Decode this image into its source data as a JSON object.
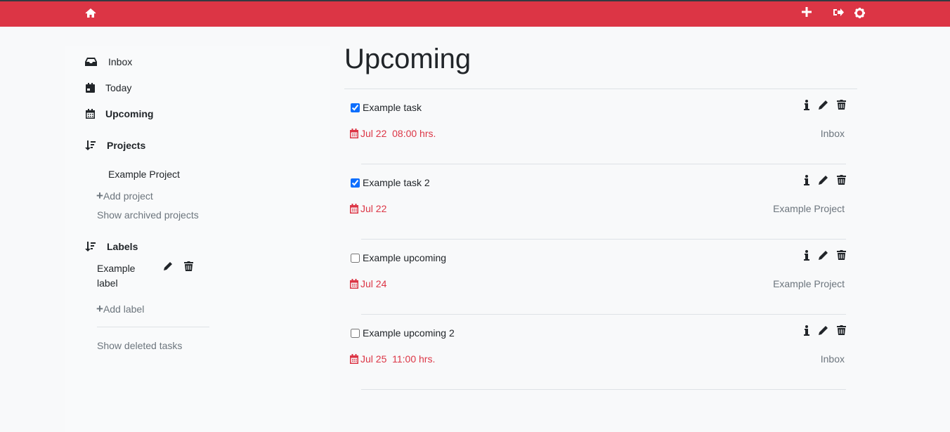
{
  "navbar": {
    "home_icon": "home-icon",
    "add_icon": "plus-icon",
    "logout_icon": "sign-out-icon",
    "settings_icon": "gear-icon",
    "brand_color": "#dc3545"
  },
  "sidebar": {
    "inbox": "Inbox",
    "today": "Today",
    "upcoming": "Upcoming",
    "projects_heading": "Projects",
    "projects": [
      "Example Project"
    ],
    "add_project": "Add project",
    "show_archived": "Show archived projects",
    "labels_heading": "Labels",
    "labels": [
      "Example label"
    ],
    "add_label": "Add label",
    "show_deleted": "Show deleted tasks"
  },
  "main": {
    "title": "Upcoming",
    "tasks": [
      {
        "name": "Example task",
        "checked": true,
        "date": "Jul 22  08:00 hrs.",
        "project": "Inbox"
      },
      {
        "name": "Example task 2",
        "checked": true,
        "date": "Jul 22",
        "project": "Example Project"
      },
      {
        "name": "Example upcoming",
        "checked": false,
        "date": "Jul 24",
        "project": "Example Project"
      },
      {
        "name": "Example upcoming 2",
        "checked": false,
        "date": "Jul 25  11:00 hrs.",
        "project": "Inbox"
      }
    ]
  }
}
